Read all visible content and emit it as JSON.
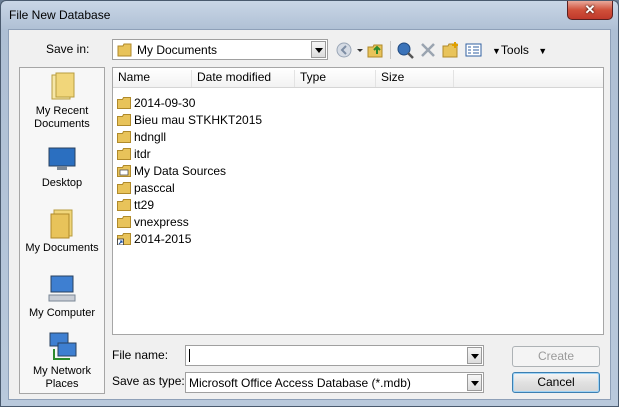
{
  "window": {
    "title": "File New Database",
    "close": "✕"
  },
  "toolbar": {
    "save_in_label": "Save in:",
    "location": "My Documents",
    "tools_label": "Tools"
  },
  "places": [
    {
      "label": "My Recent Documents",
      "icon": "recent-documents-icon"
    },
    {
      "label": "Desktop",
      "icon": "desktop-icon"
    },
    {
      "label": "My Documents",
      "icon": "my-documents-icon"
    },
    {
      "label": "My Computer",
      "icon": "my-computer-icon"
    },
    {
      "label": "My Network Places",
      "icon": "network-places-icon"
    }
  ],
  "columns": [
    "Name",
    "Date modified",
    "Type",
    "Size"
  ],
  "files": [
    {
      "name": "2014-09-30",
      "kind": "folder"
    },
    {
      "name": "Bieu mau STKHKT2015",
      "kind": "folder"
    },
    {
      "name": "hdngll",
      "kind": "folder"
    },
    {
      "name": "itdr",
      "kind": "folder"
    },
    {
      "name": "My Data Sources",
      "kind": "data-sources-folder"
    },
    {
      "name": "pasccal",
      "kind": "folder"
    },
    {
      "name": "tt29",
      "kind": "folder"
    },
    {
      "name": "vnexpress",
      "kind": "folder"
    },
    {
      "name": "2014-2015",
      "kind": "shortcut-folder"
    }
  ],
  "footer": {
    "file_name_label": "File name:",
    "file_name_value": "",
    "save_as_type_label": "Save as type:",
    "save_as_type_value": "Microsoft Office Access Database (*.mdb)",
    "create_label": "Create",
    "cancel_label": "Cancel"
  },
  "colors": {
    "folder": "#e8c35a",
    "titlebar": "#bccbde",
    "close": "#c0392b"
  }
}
